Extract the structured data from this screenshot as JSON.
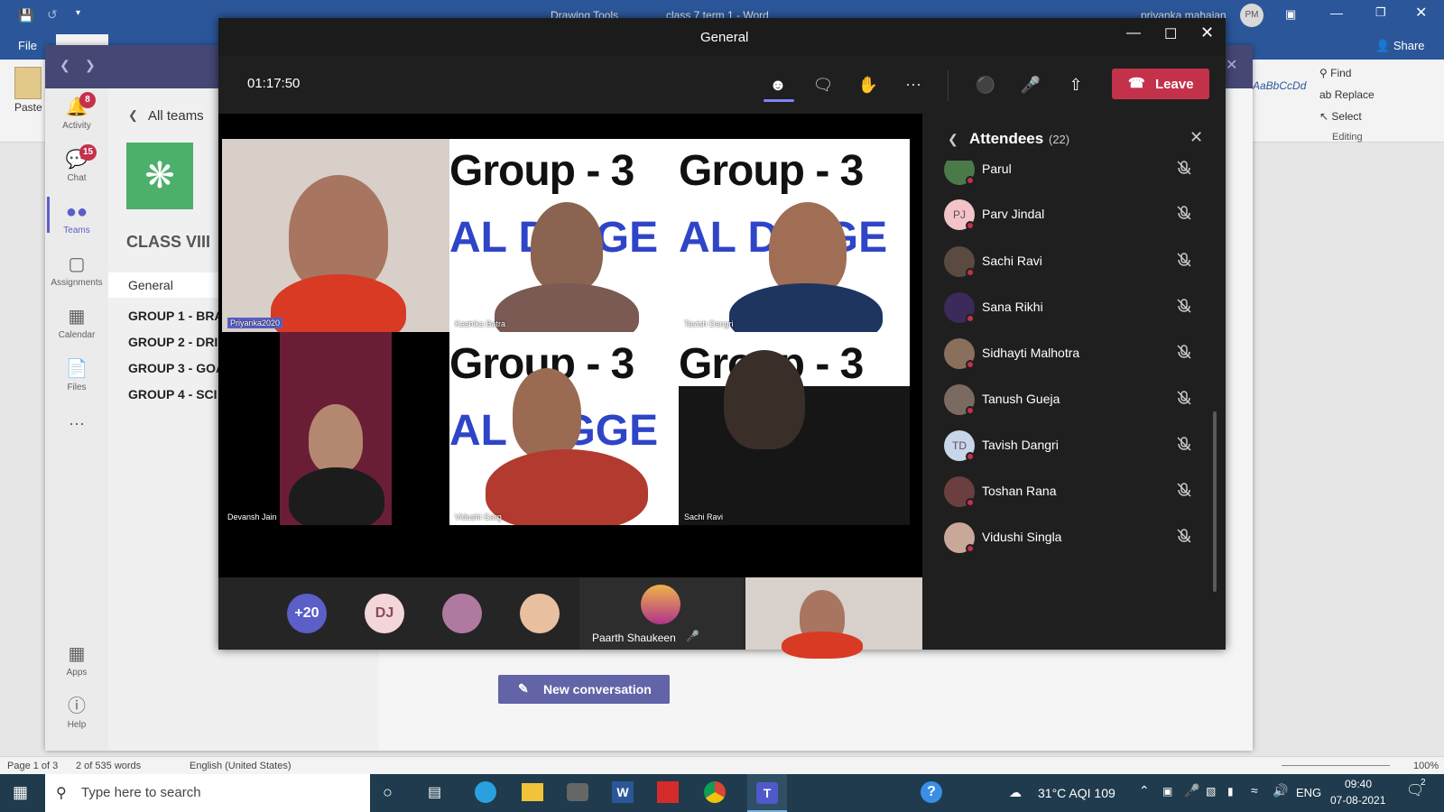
{
  "word": {
    "drawing_tools": "Drawing Tools",
    "doc_title": "class 7 term 1  -  Word",
    "user_name": "priyanka mahajan",
    "user_initials": "PM",
    "file_tab": "File",
    "share_label": "Share",
    "paste_label": "Paste",
    "find_label": "Find",
    "replace_label": "Replace",
    "select_label": "Select",
    "editing_label": "Editing",
    "style_preview": "AaBbCcDd",
    "status": {
      "page": "Page 1 of 3",
      "words": "2 of 535 words",
      "language": "English (United States)",
      "zoom": "100%"
    }
  },
  "taskbar": {
    "search_placeholder": "Type here to search",
    "weather": "31°C  AQI 109",
    "lang": "ENG",
    "time": "09:40",
    "date": "07-08-2021",
    "notif": "2"
  },
  "teams": {
    "rail": [
      {
        "label": "Activity",
        "badge": "8"
      },
      {
        "label": "Chat",
        "badge": "15"
      },
      {
        "label": "Teams",
        "badge": ""
      },
      {
        "label": "Assignments",
        "badge": ""
      },
      {
        "label": "Calendar",
        "badge": ""
      },
      {
        "label": "Files",
        "badge": ""
      },
      {
        "label": "Apps",
        "badge": ""
      },
      {
        "label": "Help",
        "badge": ""
      }
    ],
    "all_teams": "All teams",
    "team_name": "CLASS VIII",
    "channels": [
      "General",
      "GROUP 1 - BRA",
      "GROUP 2 - DRI",
      "GROUP 3 - GOA",
      "GROUP 4 - SCI"
    ],
    "new_conversation": "New conversation"
  },
  "meeting": {
    "title": "General",
    "timer": "01:17:50",
    "leave": "Leave",
    "group_text": "Group - 3",
    "al_text": "AL DIGGE",
    "tiles": [
      {
        "name": "Priyanka2020"
      },
      {
        "name": "Kashika Batra"
      },
      {
        "name": "Tavish Dangri"
      },
      {
        "name": "Devansh Jain"
      },
      {
        "name": "Vidushi Garg"
      },
      {
        "name": "Sachi Ravi"
      }
    ],
    "strip": {
      "more": "+20",
      "dj": "DJ",
      "speaker": "Paarth Shaukeen"
    },
    "attendees": {
      "title": "Attendees",
      "count": "(22)",
      "list": [
        {
          "name": "Parul",
          "initials": "",
          "color": "#4a7a4a"
        },
        {
          "name": "Parv Jindal",
          "initials": "PJ",
          "color": "#f2c4c8"
        },
        {
          "name": "Sachi Ravi",
          "initials": "",
          "color": "#5a4a3f"
        },
        {
          "name": "Sana Rikhi",
          "initials": "",
          "color": "#3b2a5a"
        },
        {
          "name": "Sidhayti Malhotra",
          "initials": "",
          "color": "#8a6f5c"
        },
        {
          "name": "Tanush Gueja",
          "initials": "",
          "color": "#7a6a62"
        },
        {
          "name": "Tavish Dangri",
          "initials": "TD",
          "color": "#c8d6ea"
        },
        {
          "name": "Toshan Rana",
          "initials": "",
          "color": "#6b3f3f"
        },
        {
          "name": "Vidushi Singla",
          "initials": "",
          "color": "#c9a89a"
        }
      ]
    }
  }
}
